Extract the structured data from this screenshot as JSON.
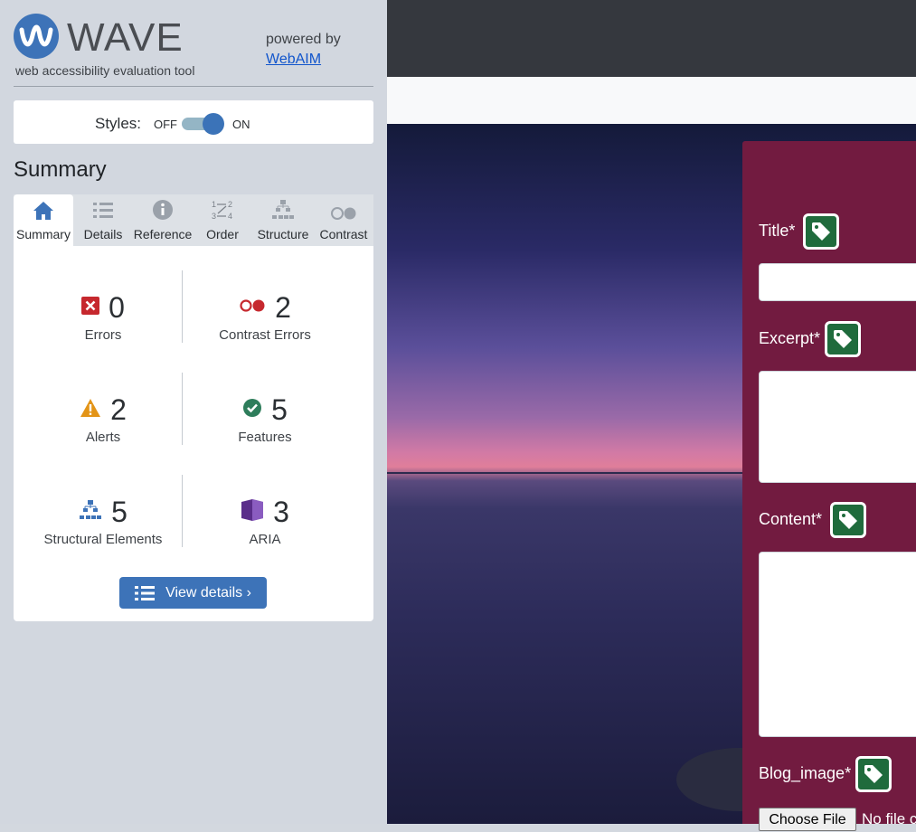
{
  "wave": {
    "brand": "WAVE",
    "tagline": "web accessibility evaluation tool",
    "powered_by": "powered by",
    "powered_link": "WebAIM"
  },
  "styles": {
    "label": "Styles:",
    "off": "OFF",
    "on": "ON",
    "enabled": true
  },
  "summary": {
    "title": "Summary"
  },
  "tabs": [
    {
      "label": "Summary",
      "icon": "home-icon",
      "active": true
    },
    {
      "label": "Details",
      "icon": "list-icon"
    },
    {
      "label": "Reference",
      "icon": "info-icon"
    },
    {
      "label": "Order",
      "icon": "order-icon"
    },
    {
      "label": "Structure",
      "icon": "structure-icon"
    },
    {
      "label": "Contrast",
      "icon": "contrast-icon"
    }
  ],
  "stats": [
    {
      "count": "0",
      "name": "Errors",
      "icon": "error-icon"
    },
    {
      "count": "2",
      "name": "Contrast Errors",
      "icon": "contrast-error-icon"
    },
    {
      "count": "2",
      "name": "Alerts",
      "icon": "alert-icon"
    },
    {
      "count": "5",
      "name": "Features",
      "icon": "feature-icon"
    },
    {
      "count": "5",
      "name": "Structural Elements",
      "icon": "structure-icon"
    },
    {
      "count": "3",
      "name": "ARIA",
      "icon": "aria-icon"
    }
  ],
  "view_details": "View details ›",
  "form": {
    "fields": [
      {
        "label": "Title*"
      },
      {
        "label": "Excerpt*"
      },
      {
        "label": "Content*"
      },
      {
        "label": "Blog_image*"
      }
    ],
    "file_button": "Choose File",
    "file_none": "No file chosen"
  },
  "colors": {
    "accent": "#3d73b8",
    "form_bg": "#721b40",
    "tag_green": "#1f6b3c",
    "topbar": "#35383e"
  }
}
